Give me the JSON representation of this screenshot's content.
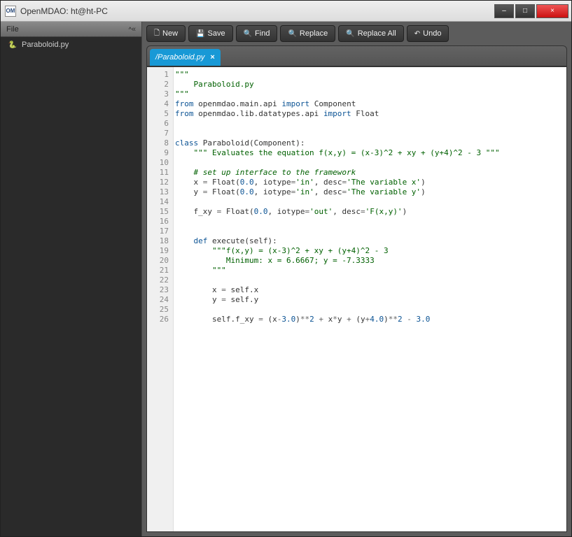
{
  "window": {
    "app_icon_text": "OM",
    "title": "OpenMDAO: ht@ht-PC",
    "min_label": "–",
    "max_label": "□",
    "close_label": "×"
  },
  "sidebar": {
    "header_label": "File",
    "caret": "^",
    "collapse_label": "«",
    "items": [
      {
        "icon": "🐍",
        "name": "Paraboloid.py"
      }
    ]
  },
  "toolbar": {
    "new_icon": "🗋",
    "new_label": "New",
    "save_icon": "💾",
    "save_label": "Save",
    "find_icon": "🔍",
    "find_label": "Find",
    "replace_icon": "🔍",
    "replace_label": "Replace",
    "replaceall_icon": "🔍",
    "replaceall_label": "Replace All",
    "undo_icon": "↶",
    "undo_label": "Undo"
  },
  "tabs": [
    {
      "label": "/Paraboloid.py",
      "close": "×"
    }
  ],
  "editor": {
    "line_count": 26,
    "lines": [
      {
        "n": 1,
        "t": "str",
        "text": "\"\"\""
      },
      {
        "n": 2,
        "t": "str",
        "text": "    Paraboloid.py"
      },
      {
        "n": 3,
        "t": "str",
        "text": "\"\"\""
      },
      {
        "n": 4,
        "t": "code",
        "seg": [
          [
            "kw",
            "from"
          ],
          [
            "p",
            " openmdao.main.api "
          ],
          [
            "kw",
            "import"
          ],
          [
            "p",
            " Component"
          ]
        ]
      },
      {
        "n": 5,
        "t": "code",
        "seg": [
          [
            "kw",
            "from"
          ],
          [
            "p",
            " openmdao.lib.datatypes.api "
          ],
          [
            "kw",
            "import"
          ],
          [
            "p",
            " Float"
          ]
        ]
      },
      {
        "n": 6,
        "t": "blank",
        "text": ""
      },
      {
        "n": 7,
        "t": "blank",
        "text": ""
      },
      {
        "n": 8,
        "t": "code",
        "seg": [
          [
            "kw",
            "class"
          ],
          [
            "p",
            " Paraboloid(Component):"
          ]
        ]
      },
      {
        "n": 9,
        "t": "str2",
        "text": "    \"\"\" Evaluates the equation f(x,y) = (x-3)^2 + xy + (y+4)^2 - 3 \"\"\""
      },
      {
        "n": 10,
        "t": "blank",
        "text": ""
      },
      {
        "n": 11,
        "t": "com",
        "text": "    # set up interface to the framework"
      },
      {
        "n": 12,
        "t": "code",
        "seg": [
          [
            "p",
            "    x "
          ],
          [
            "op",
            "="
          ],
          [
            "p",
            " Float("
          ],
          [
            "num",
            "0.0"
          ],
          [
            "p",
            ", iotype"
          ],
          [
            "op",
            "="
          ],
          [
            "str",
            "'in'"
          ],
          [
            "p",
            ", desc"
          ],
          [
            "op",
            "="
          ],
          [
            "str",
            "'The variable x'"
          ],
          [
            "p",
            ")"
          ]
        ]
      },
      {
        "n": 13,
        "t": "code",
        "seg": [
          [
            "p",
            "    y "
          ],
          [
            "op",
            "="
          ],
          [
            "p",
            " Float("
          ],
          [
            "num",
            "0.0"
          ],
          [
            "p",
            ", iotype"
          ],
          [
            "op",
            "="
          ],
          [
            "str",
            "'in'"
          ],
          [
            "p",
            ", desc"
          ],
          [
            "op",
            "="
          ],
          [
            "str",
            "'The variable y'"
          ],
          [
            "p",
            ")"
          ]
        ]
      },
      {
        "n": 14,
        "t": "blank",
        "text": ""
      },
      {
        "n": 15,
        "t": "code",
        "seg": [
          [
            "p",
            "    f_xy "
          ],
          [
            "op",
            "="
          ],
          [
            "p",
            " Float("
          ],
          [
            "num",
            "0.0"
          ],
          [
            "p",
            ", iotype"
          ],
          [
            "op",
            "="
          ],
          [
            "str",
            "'out'"
          ],
          [
            "p",
            ", desc"
          ],
          [
            "op",
            "="
          ],
          [
            "str",
            "'F(x,y)'"
          ],
          [
            "p",
            ")"
          ]
        ]
      },
      {
        "n": 16,
        "t": "blank",
        "text": ""
      },
      {
        "n": 17,
        "t": "blank",
        "text": ""
      },
      {
        "n": 18,
        "t": "code",
        "seg": [
          [
            "p",
            "    "
          ],
          [
            "kw",
            "def"
          ],
          [
            "p",
            " execute(self):"
          ]
        ]
      },
      {
        "n": 19,
        "t": "str2",
        "text": "        \"\"\"f(x,y) = (x-3)^2 + xy + (y+4)^2 - 3"
      },
      {
        "n": 20,
        "t": "str2",
        "text": "           Minimum: x = 6.6667; y = -7.3333"
      },
      {
        "n": 21,
        "t": "str2",
        "text": "        \"\"\""
      },
      {
        "n": 22,
        "t": "blank",
        "text": ""
      },
      {
        "n": 23,
        "t": "code",
        "seg": [
          [
            "p",
            "        x "
          ],
          [
            "op",
            "="
          ],
          [
            "p",
            " self.x"
          ]
        ]
      },
      {
        "n": 24,
        "t": "code",
        "seg": [
          [
            "p",
            "        y "
          ],
          [
            "op",
            "="
          ],
          [
            "p",
            " self.y"
          ]
        ]
      },
      {
        "n": 25,
        "t": "blank",
        "text": ""
      },
      {
        "n": 26,
        "t": "code",
        "seg": [
          [
            "p",
            "        self.f_xy "
          ],
          [
            "op",
            "="
          ],
          [
            "p",
            " (x"
          ],
          [
            "op",
            "-"
          ],
          [
            "num",
            "3.0"
          ],
          [
            "p",
            ")"
          ],
          [
            "op",
            "**"
          ],
          [
            "num",
            "2"
          ],
          [
            "p",
            " "
          ],
          [
            "op",
            "+"
          ],
          [
            "p",
            " x"
          ],
          [
            "op",
            "*"
          ],
          [
            "p",
            "y "
          ],
          [
            "op",
            "+"
          ],
          [
            "p",
            " (y"
          ],
          [
            "op",
            "+"
          ],
          [
            "num",
            "4.0"
          ],
          [
            "p",
            ")"
          ],
          [
            "op",
            "**"
          ],
          [
            "num",
            "2"
          ],
          [
            "p",
            " "
          ],
          [
            "op",
            "-"
          ],
          [
            "p",
            " "
          ],
          [
            "num",
            "3.0"
          ]
        ]
      }
    ]
  }
}
